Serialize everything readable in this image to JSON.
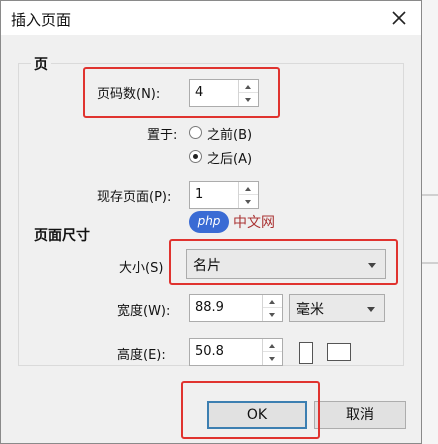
{
  "dialog": {
    "title": "插入页面",
    "colors": {
      "highlight": "#e0332f",
      "default_button_border": "#3c7fb1",
      "dialog_bg": "#f0f0f0"
    }
  },
  "page_group": {
    "label": "页",
    "page_count_label": "页码数(N):",
    "page_count_value": "4",
    "place_label": "置于:",
    "options": [
      {
        "label": "之前(B)",
        "selected": false
      },
      {
        "label": "之后(A)",
        "selected": true
      }
    ],
    "existing_page_label": "现存页面(P):",
    "existing_page_value": "1"
  },
  "size_group": {
    "label": "页面尺寸",
    "size_label": "大小(S)",
    "size_value": "名片",
    "width_label": "宽度(W):",
    "width_value": "88.9",
    "unit_value": "毫米",
    "height_label": "高度(E):",
    "height_value": "50.8"
  },
  "watermark": {
    "badge": "php",
    "text": "中文网"
  },
  "buttons": {
    "ok": "OK",
    "cancel": "取消"
  }
}
